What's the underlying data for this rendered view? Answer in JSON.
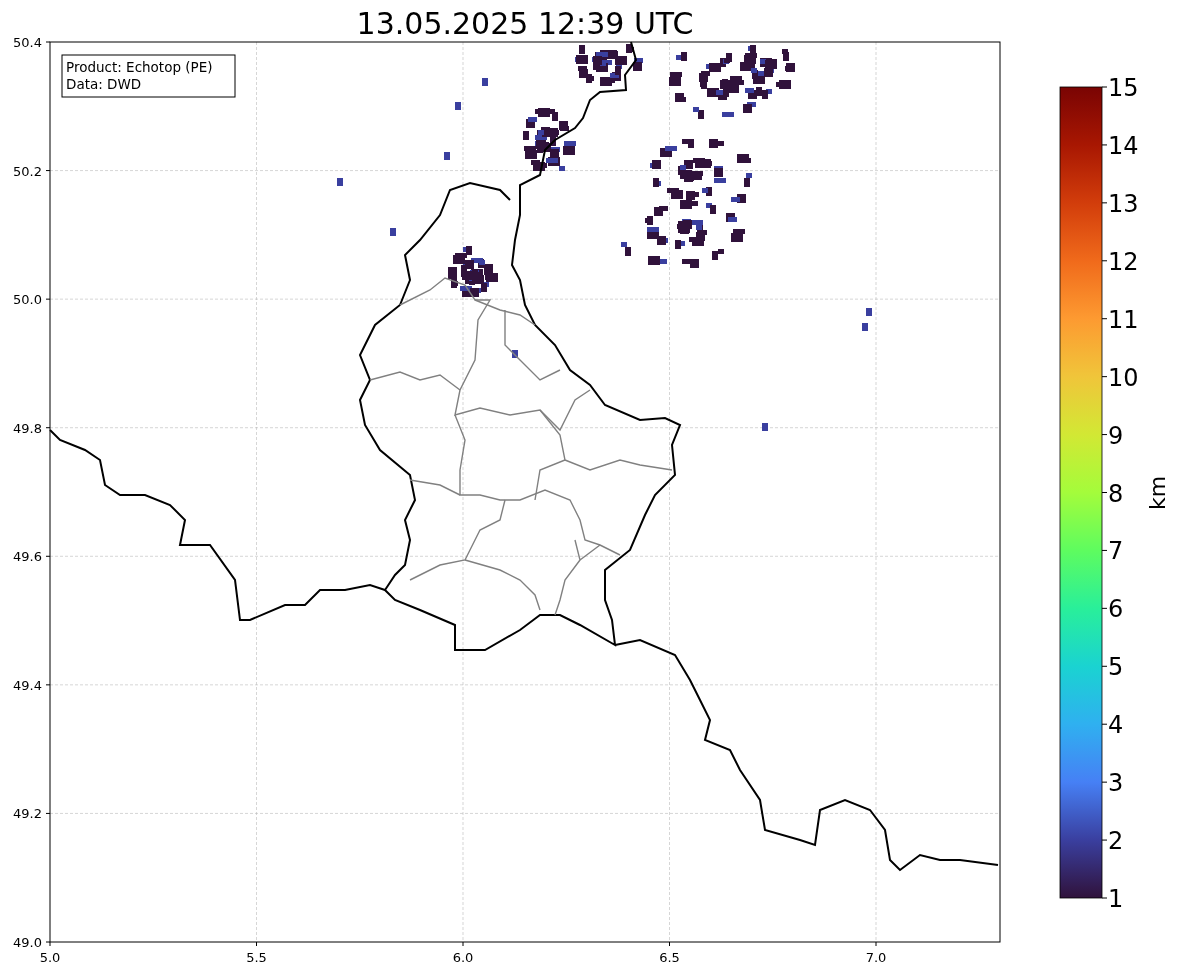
{
  "title": "13.05.2025 12:39 UTC",
  "info_box": [
    "Product: Echotop (PE)",
    "Data: DWD"
  ],
  "x_ticks": [
    "5.0",
    "5.5",
    "6.0",
    "6.5",
    "7.0"
  ],
  "y_ticks": [
    "50.4",
    "50.2",
    "50.0",
    "49.8",
    "49.6",
    "49.4",
    "49.2",
    "49.0"
  ],
  "colorbar": {
    "label": "km",
    "ticks": [
      "15",
      "14",
      "13",
      "12",
      "11",
      "10",
      "9",
      "8",
      "7",
      "6",
      "5",
      "4",
      "3",
      "2",
      "1"
    ]
  }
}
